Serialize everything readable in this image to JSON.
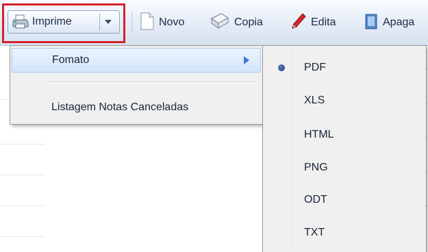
{
  "toolbar": {
    "imprime_label": "Imprime",
    "novo_label": "Novo",
    "copia_label": "Copia",
    "edita_label": "Edita",
    "apaga_label": "Apaga"
  },
  "menu": {
    "items": [
      {
        "label": "Fomato",
        "has_submenu": true
      },
      {
        "label": "Listagem Notas Canceladas"
      }
    ]
  },
  "submenu": {
    "selected": "PDF",
    "items": [
      {
        "label": "PDF"
      },
      {
        "label": "XLS"
      },
      {
        "label": "HTML"
      },
      {
        "label": "PNG"
      },
      {
        "label": "ODT"
      },
      {
        "label": "TXT"
      }
    ]
  },
  "colors": {
    "highlight_frame": "#d4222b",
    "menu_hover": "#d3e6fb",
    "submenu_arrow": "#3a7bd5"
  },
  "icons": [
    "printer-icon",
    "chevron-down-icon",
    "new-document-icon",
    "copy-icon",
    "pencil-icon",
    "delete-icon",
    "chevron-right-icon",
    "radio-bullet-icon"
  ]
}
